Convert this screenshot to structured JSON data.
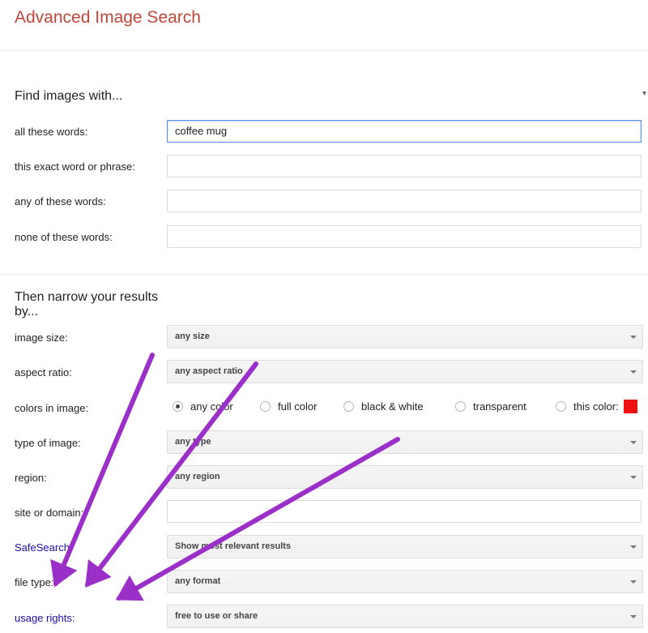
{
  "page": {
    "title": "Advanced Image Search"
  },
  "find_section": {
    "heading": "Find images with...",
    "fields": [
      {
        "label": "all these words:",
        "value": "coffee mug"
      },
      {
        "label": "this exact word or phrase:",
        "value": ""
      },
      {
        "label": "any of these words:",
        "value": ""
      },
      {
        "label": "none of these words:",
        "value": ""
      }
    ]
  },
  "narrow_section": {
    "heading_line1": "Then narrow your results",
    "heading_line2": "by...",
    "image_size": {
      "label": "image size:",
      "value": "any size"
    },
    "aspect_ratio": {
      "label": "aspect ratio:",
      "value": "any aspect ratio"
    },
    "colors": {
      "label": "colors in image:",
      "options": [
        "any color",
        "full color",
        "black & white",
        "transparent",
        "this color:"
      ],
      "selected": "any color",
      "swatch_color": "#ee1111"
    },
    "type_of_image": {
      "label": "type of image:",
      "value": "any type"
    },
    "region": {
      "label": "region:",
      "value": "any region"
    },
    "site_or_domain": {
      "label": "site or domain:",
      "value": ""
    },
    "safesearch": {
      "label": "SafeSearch:",
      "value": "Show most relevant results"
    },
    "file_type": {
      "label": "file type:",
      "value": "any format"
    },
    "usage_rights": {
      "label": "usage rights:",
      "value": "free to use or share"
    }
  },
  "annotation": {
    "arrow_color": "#9b30c8"
  }
}
